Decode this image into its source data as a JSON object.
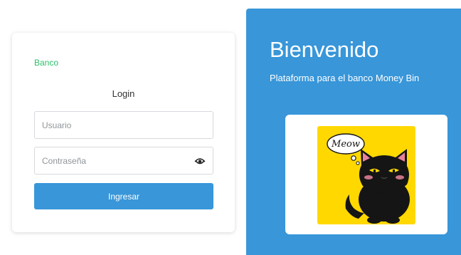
{
  "login": {
    "brand": "Banco",
    "title": "Login",
    "username_placeholder": "Usuario",
    "password_placeholder": "Contraseña",
    "submit_label": "Ingresar"
  },
  "welcome": {
    "title": "Bienvenido",
    "subtitle": "Plataforma para el banco Money Bin",
    "image_text": "Meow"
  },
  "icons": {
    "password_toggle": "eye-icon"
  },
  "colors": {
    "accent": "#3896d9",
    "brand": "#2dbf6a",
    "panel_bg": "#3896d9",
    "card_bg": "#ffffff",
    "image_bg": "#ffd800",
    "cat": "#151515"
  }
}
